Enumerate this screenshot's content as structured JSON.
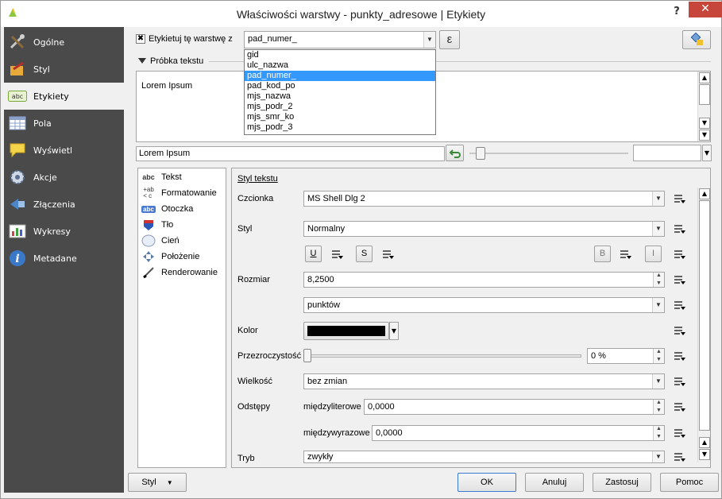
{
  "window": {
    "title": "Właściwości warstwy - punkty_adresowe | Etykiety",
    "help": "?",
    "close": "✕"
  },
  "sidebar": {
    "items": [
      {
        "label": "Ogólne",
        "icon": "tools-icon"
      },
      {
        "label": "Styl",
        "icon": "brush-icon"
      },
      {
        "label": "Etykiety",
        "icon": "abc-label-icon",
        "active": true
      },
      {
        "label": "Pola",
        "icon": "table-icon"
      },
      {
        "label": "Wyświetl",
        "icon": "speech-bubble-icon"
      },
      {
        "label": "Akcje",
        "icon": "gear-icon"
      },
      {
        "label": "Złączenia",
        "icon": "join-icon"
      },
      {
        "label": "Wykresy",
        "icon": "diagram-icon"
      },
      {
        "label": "Metadane",
        "icon": "info-icon"
      }
    ]
  },
  "label_with": {
    "checkbox_label": "Etykietuj tę warstwę z",
    "checked": true,
    "field_value": "pad_numer_",
    "expression_symbol": "ε"
  },
  "field_options": [
    "gid",
    "ulc_nazwa",
    "pad_numer_",
    "pad_kod_po",
    "mjs_nazwa",
    "mjs_podr_2",
    "mjs_smr_ko",
    "mjs_podr_3"
  ],
  "field_selected_index": 2,
  "preview": {
    "section_label": "Próbka tekstu",
    "text": "Lorem Ipsum",
    "input_value": "Lorem Ipsum"
  },
  "tabs": [
    {
      "label": "Tekst",
      "icon": "abc-icon"
    },
    {
      "label": "Formatowanie",
      "icon": "format-icon"
    },
    {
      "label": "Otoczka",
      "icon": "buffer-icon"
    },
    {
      "label": "Tło",
      "icon": "background-icon"
    },
    {
      "label": "Cień",
      "icon": "shadow-icon"
    },
    {
      "label": "Położenie",
      "icon": "placement-icon"
    },
    {
      "label": "Renderowanie",
      "icon": "render-icon"
    }
  ],
  "text_style": {
    "heading": "Styl tekstu",
    "font_label": "Czcionka",
    "font_value": "MS Shell Dlg 2",
    "style_label": "Styl",
    "style_value": "Normalny",
    "underline": "U",
    "strike": "S",
    "bold": "B",
    "italic": "I",
    "size_label": "Rozmiar",
    "size_value": "8,2500",
    "size_unit": "punktów",
    "color_label": "Kolor",
    "color": "#000000",
    "transparency_label": "Przezroczystość",
    "transparency_value": "0 %",
    "transparency_level": 0,
    "case_label": "Wielkość",
    "case_value": "bez zmian",
    "spacing_label": "Odstępy",
    "letter_label": "międzyliterowe",
    "letter_value": "0,0000",
    "word_label": "międzywyrazowe",
    "word_value": "0,0000",
    "mode_label": "Tryb",
    "mode_value": "zwykły"
  },
  "footer": {
    "style_button": "Styl",
    "ok": "OK",
    "cancel": "Anuluj",
    "apply": "Zastosuj",
    "help": "Pomoc"
  }
}
